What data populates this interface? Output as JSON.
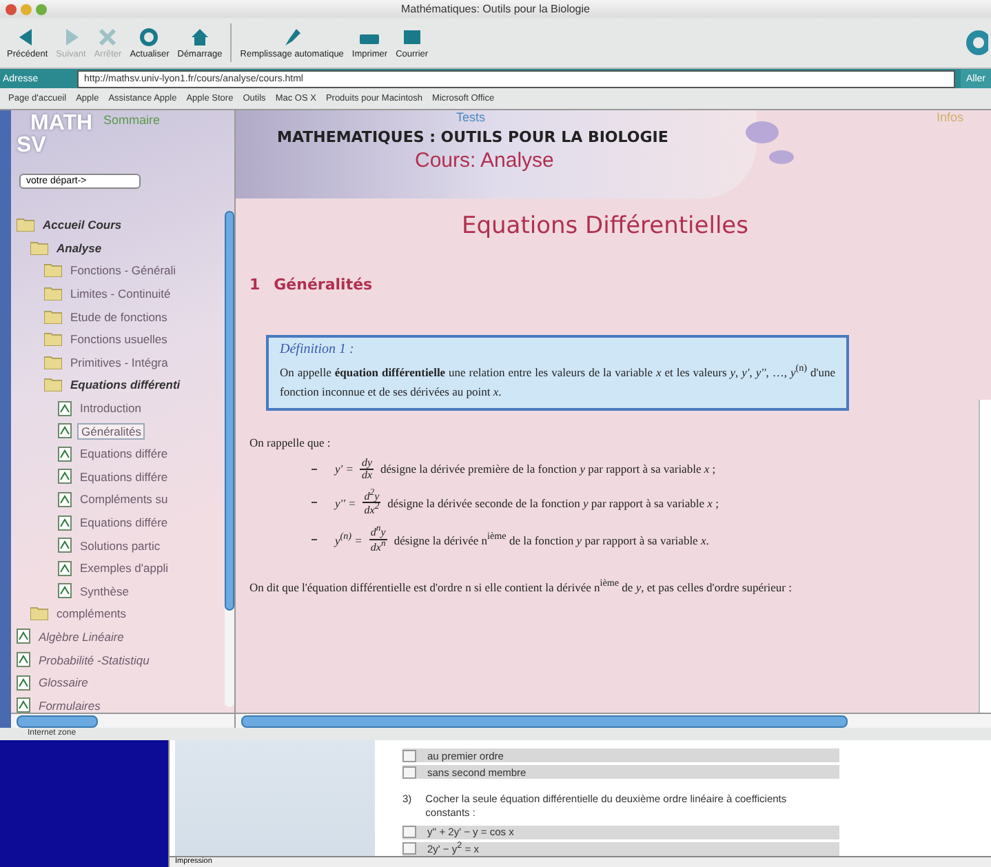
{
  "window": {
    "title": "Mathématiques: Outils pour la Biologie"
  },
  "toolbar": [
    {
      "label": "Précédent",
      "kind": "back",
      "disabled": false
    },
    {
      "label": "Suivant",
      "kind": "forward",
      "disabled": true
    },
    {
      "label": "Arrêter",
      "kind": "stop",
      "disabled": true
    },
    {
      "label": "Actualiser",
      "kind": "refresh",
      "disabled": false
    },
    {
      "label": "Démarrage",
      "kind": "home",
      "disabled": false
    },
    {
      "label": "Remplissage automatique",
      "kind": "fill",
      "disabled": false
    },
    {
      "label": "Imprimer",
      "kind": "print",
      "disabled": false
    },
    {
      "label": "Courrier",
      "kind": "mail",
      "disabled": false
    }
  ],
  "address": {
    "label": "Adresse",
    "value": "http://mathsv.univ-lyon1.fr/cours/analyse/cours.html",
    "go": "Aller"
  },
  "favorites": [
    "Page d'accueil",
    "Apple",
    "Assistance Apple",
    "Apple Store",
    "Outils",
    "Mac OS X",
    "Produits pour Macintosh",
    "Microsoft Office"
  ],
  "sidebar": {
    "logo_top": "MATH",
    "logo_bottom": "SV",
    "tab": "Sommaire",
    "select": "votre départ->",
    "tree": [
      {
        "label": "Accueil Cours",
        "kind": "folder",
        "expanded": true,
        "selected": false,
        "children": [
          {
            "label": "Analyse",
            "kind": "folder",
            "expanded": true,
            "selected": false,
            "children": [
              {
                "label": "Fonctions - Générali",
                "kind": "folder",
                "expanded": false,
                "selected": false
              },
              {
                "label": "Limites - Continuité",
                "kind": "folder",
                "expanded": false,
                "selected": false
              },
              {
                "label": "Etude de fonctions",
                "kind": "folder",
                "expanded": false,
                "selected": false
              },
              {
                "label": "Fonctions usuelles",
                "kind": "folder",
                "expanded": false,
                "selected": false
              },
              {
                "label": "Primitives - Intégra",
                "kind": "folder",
                "expanded": false,
                "selected": false
              },
              {
                "label": "Equations différenti",
                "kind": "folder",
                "expanded": true,
                "selected": false,
                "children": [
                  {
                    "label": "Introduction",
                    "kind": "page",
                    "selected": false
                  },
                  {
                    "label": "Généralités",
                    "kind": "page",
                    "selected": true
                  },
                  {
                    "label": "Equations différe",
                    "kind": "page",
                    "selected": false
                  },
                  {
                    "label": "Equations différe",
                    "kind": "page",
                    "selected": false
                  },
                  {
                    "label": "Compléments su",
                    "kind": "page",
                    "selected": false
                  },
                  {
                    "label": "Equations différe",
                    "kind": "page",
                    "selected": false
                  },
                  {
                    "label": "Solutions partic",
                    "kind": "page",
                    "selected": false
                  },
                  {
                    "label": "Exemples d'appli",
                    "kind": "page",
                    "selected": false
                  },
                  {
                    "label": "Synthèse",
                    "kind": "page",
                    "selected": false
                  }
                ]
              }
            ]
          },
          {
            "label": "compléments",
            "kind": "folder",
            "expanded": false,
            "selected": false
          }
        ]
      },
      {
        "label": "Algèbre Linéaire",
        "kind": "page",
        "selected": false
      },
      {
        "label": "Probabilité -Statistiqu",
        "kind": "page",
        "selected": false
      },
      {
        "label": "Glossaire",
        "kind": "page",
        "selected": false
      },
      {
        "label": "Formulaires",
        "kind": "page",
        "selected": false
      }
    ]
  },
  "banner": {
    "tests": "Tests",
    "infos": "Infos",
    "title": "MATHEMATIQUES : OUTILS POUR LA BIOLOGIE",
    "course": "Cours: Analyse"
  },
  "page": {
    "heading": "Equations Différentielles",
    "section_number": "1",
    "section": "Généralités",
    "definition": {
      "title": "Définition 1 :",
      "text": "On appelle **équation différentielle** une relation entre les valeurs de la variable *x* et les valeurs *y*, *y'*, *y''*, …, *y*$^{(n)}$ d'une fonction inconnue et de ses dérivées au point *x*."
    },
    "intro": "On rappelle que :",
    "items": [
      {
        "lhs": "y' =",
        "num": "dy",
        "den": "dx",
        "text": "désigne la dérivée première de la fonction *y* par rapport à sa variable *x* ;"
      },
      {
        "lhs": "y'' =",
        "num": "d$^{2}$y",
        "den": "dx$^{2}$",
        "text": "désigne la dérivée seconde de la fonction *y* par rapport à sa variable *x* ;"
      },
      {
        "lhs": "y$^{(n)}$ =",
        "num": "d$^{n}$y",
        "den": "dx$^{n}$",
        "text": "désigne la dérivée n$^{ième}$ de la fonction *y* par rapport à sa variable *x*."
      }
    ],
    "outro": "On dit que l'équation différentielle est d'ordre n si elle contient la dérivée n$^{ième}$ de *y*, et pas celles d'ordre supérieur :"
  },
  "status_bar": "Internet zone",
  "back_window": {
    "options_top": [
      {
        "label": "au premier ordre",
        "checked": false
      },
      {
        "label": "sans second membre",
        "checked": false
      }
    ],
    "question_number": "3)",
    "question": "Cocher la seule équation différentielle du deuxième ordre linéaire à coefficients constants :",
    "options": [
      {
        "label": "y'' + 2y' − y = cos x",
        "checked": false
      },
      {
        "label": "2y' − y$^{2}$ = x",
        "checked": false
      }
    ],
    "status": "Impression"
  }
}
